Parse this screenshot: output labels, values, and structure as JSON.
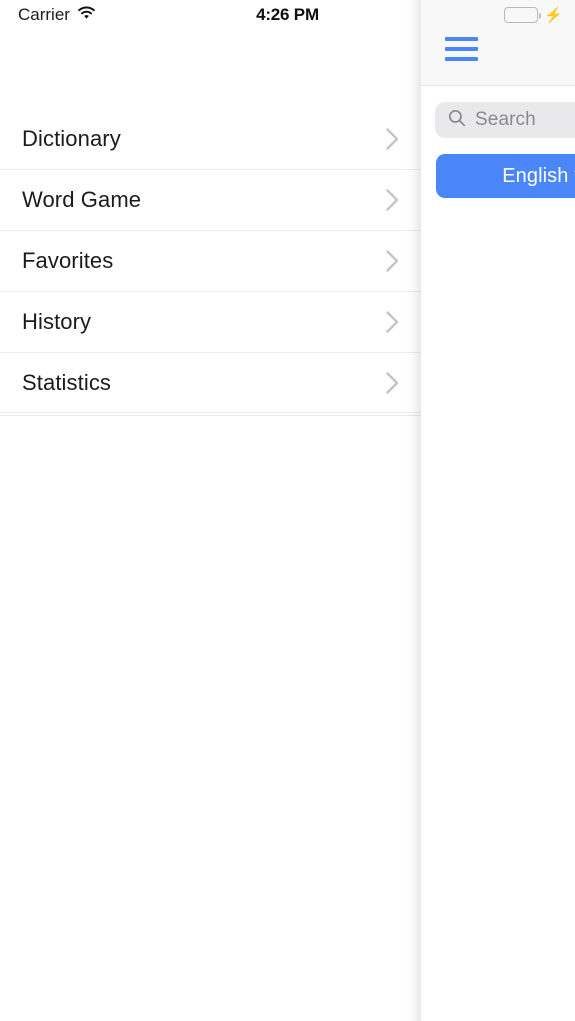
{
  "status_bar": {
    "carrier": "Carrier",
    "wifi_icon": "wifi-icon",
    "time": "4:26 PM",
    "battery_icon": "battery-icon",
    "charging_icon": "lightning-bolt-icon",
    "battery_color": "#4cd964"
  },
  "menu": {
    "items": [
      {
        "label": "Dictionary",
        "chevron": "chevron-right-icon"
      },
      {
        "label": "Word Game",
        "chevron": "chevron-right-icon"
      },
      {
        "label": "Favorites",
        "chevron": "chevron-right-icon"
      },
      {
        "label": "History",
        "chevron": "chevron-right-icon"
      },
      {
        "label": "Statistics",
        "chevron": "chevron-right-icon"
      }
    ]
  },
  "drawer": {
    "menu_icon": "hamburger-menu-icon",
    "accent_color": "#4a86f7",
    "search": {
      "icon": "search-icon",
      "placeholder": "Search",
      "value": ""
    },
    "language_button": {
      "label": "English t",
      "icon": "language-icon",
      "color": "#4a86f7"
    }
  }
}
